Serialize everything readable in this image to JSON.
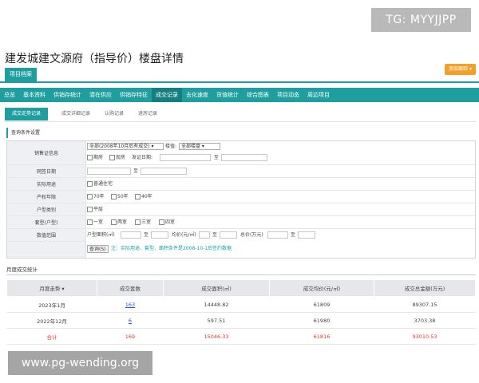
{
  "watermark_top": "TG: MYYJJPP",
  "watermark_bottom": "www.pg-wending.org",
  "page_title": "建发城建文源府（指导价）楼盘详情",
  "top_tab": "项目档案",
  "orange_button": "添加跟踪 ▾",
  "nav": [
    "总览",
    "基本资料",
    "供销存统计",
    "潜在供应",
    "供销存特征",
    "成交记录",
    "去化速度",
    "货值统计",
    "综合图表",
    "项目动态",
    "周边项目"
  ],
  "nav_active_index": 5,
  "subtabs": [
    "成交走势记录",
    "成交详细记录",
    "认购记录",
    "退房记录"
  ],
  "query": {
    "header": "查询条件设置",
    "labels": [
      "销售证信息",
      "网签日期",
      "实际用途",
      "产权年限",
      "户型类别",
      "套型(户型)",
      "数值范围"
    ],
    "sale_select": "全部(2008年10月后有成交) ▾",
    "building_label": "楼值:",
    "building_select": "全部楼盘 ▾",
    "opt_presale": "期房",
    "opt_existing": "现房",
    "cert_date_label": "发证日期:",
    "to": "至",
    "usage_opt": "普通住宅",
    "years": [
      "70年",
      "50年",
      "40年"
    ],
    "unit_type_opt": "平层",
    "rooms": [
      "一室",
      "两室",
      "三室",
      "四室"
    ],
    "area_label": "户型面积(㎡)",
    "price_label": "均价(元/㎡)",
    "total_label": "总价(万元)",
    "search_btn": "查询(S)",
    "note": "注：实际用途、套型、面积条件是2008-10-1后签约数据"
  },
  "monthly": {
    "title": "月度成交统计",
    "columns": [
      "月度走势 ▾",
      "成交套数",
      "成交面积(㎡)",
      "成交均价(元/㎡)",
      "成交总金额(万元)"
    ],
    "rows": [
      [
        "2023年1月",
        "163",
        "14448.82",
        "61809",
        "89307.15"
      ],
      [
        "2022年12月",
        "6",
        "597.51",
        "61980",
        "3703.38"
      ]
    ],
    "total": [
      "合计",
      "169",
      "15046.33",
      "61816",
      "93010.53"
    ]
  }
}
